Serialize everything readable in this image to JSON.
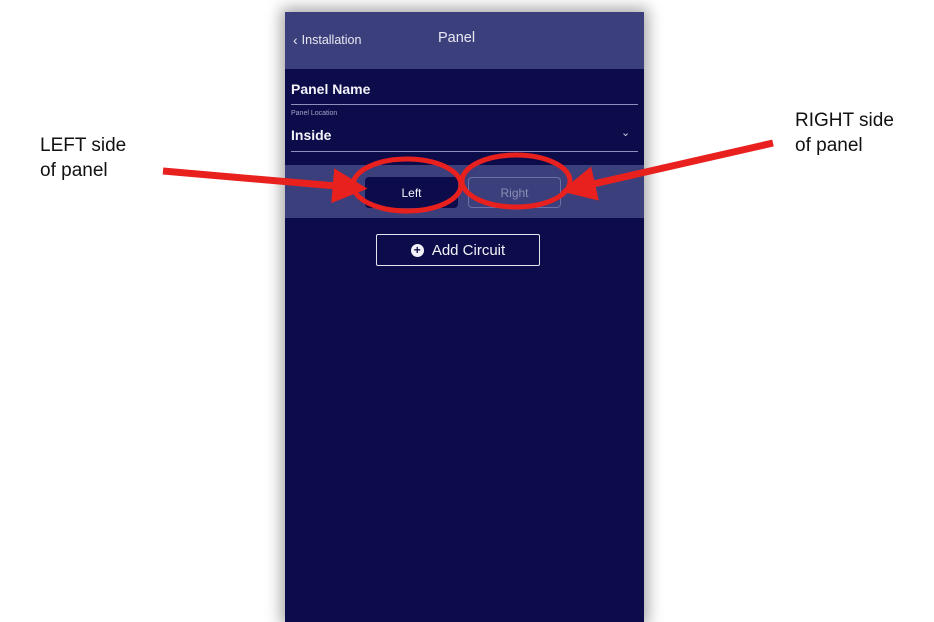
{
  "annotations": {
    "left_line1": "LEFT side",
    "left_line2": "of panel",
    "right_line1": "RIGHT side",
    "right_line2": "of panel",
    "highlight_color": "#e8201e"
  },
  "header": {
    "back_label": "Installation",
    "title": "Panel"
  },
  "form": {
    "panel_name_value": "Panel Name",
    "location_label": "Panel Location",
    "location_value": "Inside"
  },
  "segments": {
    "left_label": "Left",
    "right_label": "Right",
    "selected": "Left"
  },
  "actions": {
    "add_circuit_label": "Add Circuit"
  },
  "icons": {
    "back": "chevron-left-icon",
    "location_dropdown": "chevron-down-icon",
    "add_circuit": "plus-circle-icon"
  },
  "colors": {
    "phone_bg": "#0c0c4a",
    "bar_bg": "#3b3f7c"
  }
}
